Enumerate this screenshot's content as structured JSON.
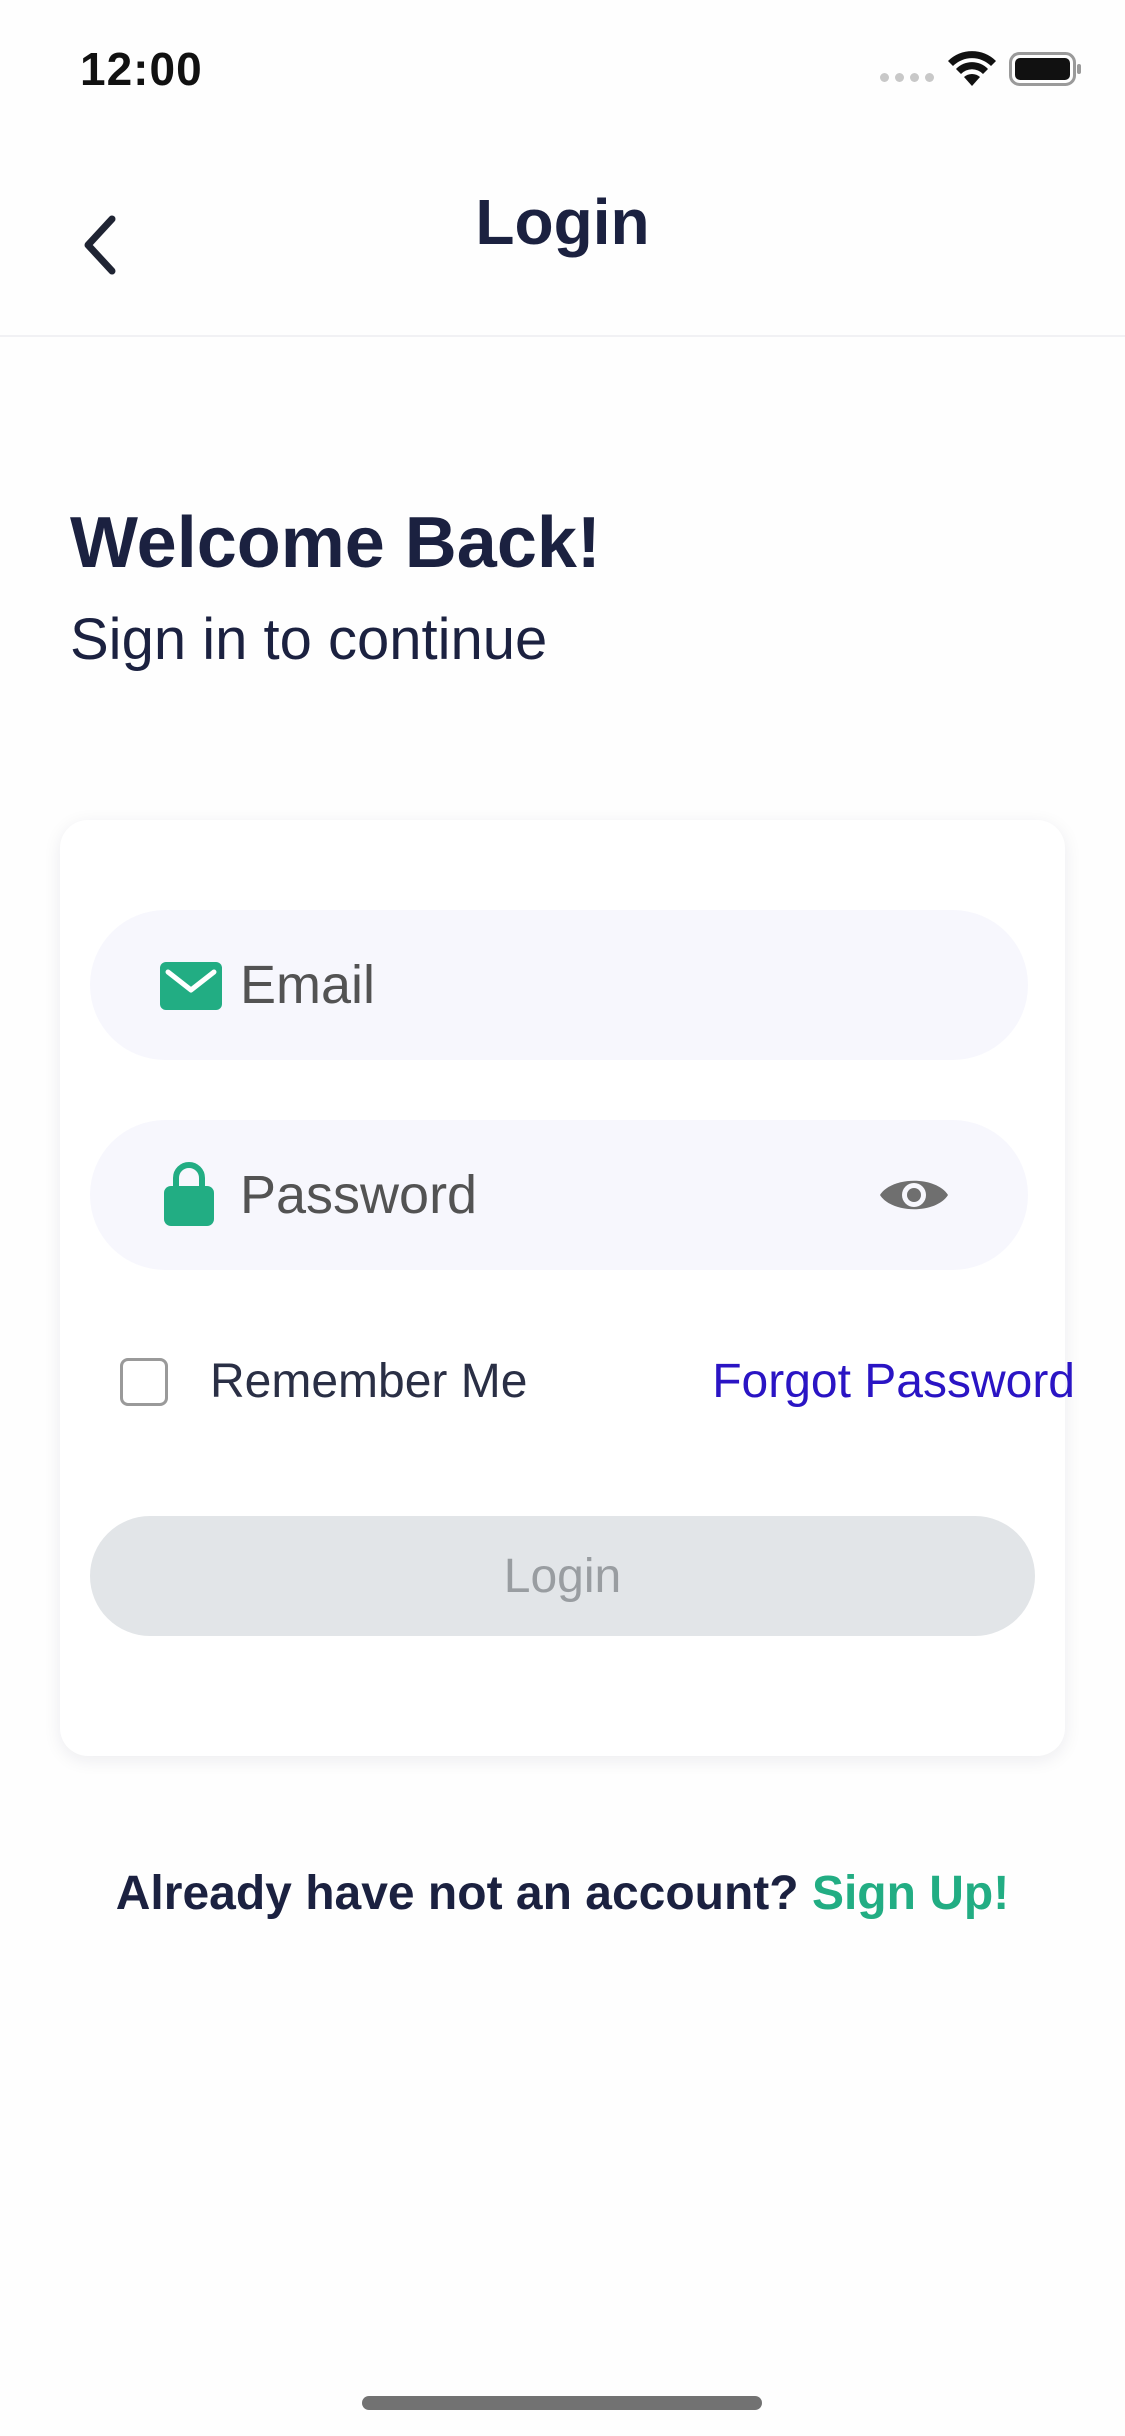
{
  "status_bar": {
    "time": "12:00",
    "signal_icon": "cellular-dots-icon",
    "wifi_icon": "wifi-icon",
    "battery_icon": "battery-full-icon"
  },
  "nav": {
    "back_icon": "chevron-left-icon",
    "title": "Login"
  },
  "heading": {
    "title": "Welcome Back!",
    "subtitle": "Sign in to continue"
  },
  "form": {
    "email": {
      "icon": "envelope-icon",
      "placeholder": "Email",
      "value": ""
    },
    "password": {
      "icon": "lock-icon",
      "placeholder": "Password",
      "value": "",
      "toggle_icon": "eye-icon"
    },
    "remember_label": "Remember Me",
    "remember_checked": false,
    "forgot_label": "Forgot Password",
    "login_label": "Login"
  },
  "footer": {
    "prompt": "Already have not an account?",
    "signup_label": "Sign Up!"
  },
  "colors": {
    "accent": "#22ad83",
    "link": "#2a14c4",
    "heading": "#1b2140",
    "field_bg": "#f7f7fd",
    "button_disabled_bg": "#e2e5e8",
    "button_disabled_text": "#999da1"
  }
}
